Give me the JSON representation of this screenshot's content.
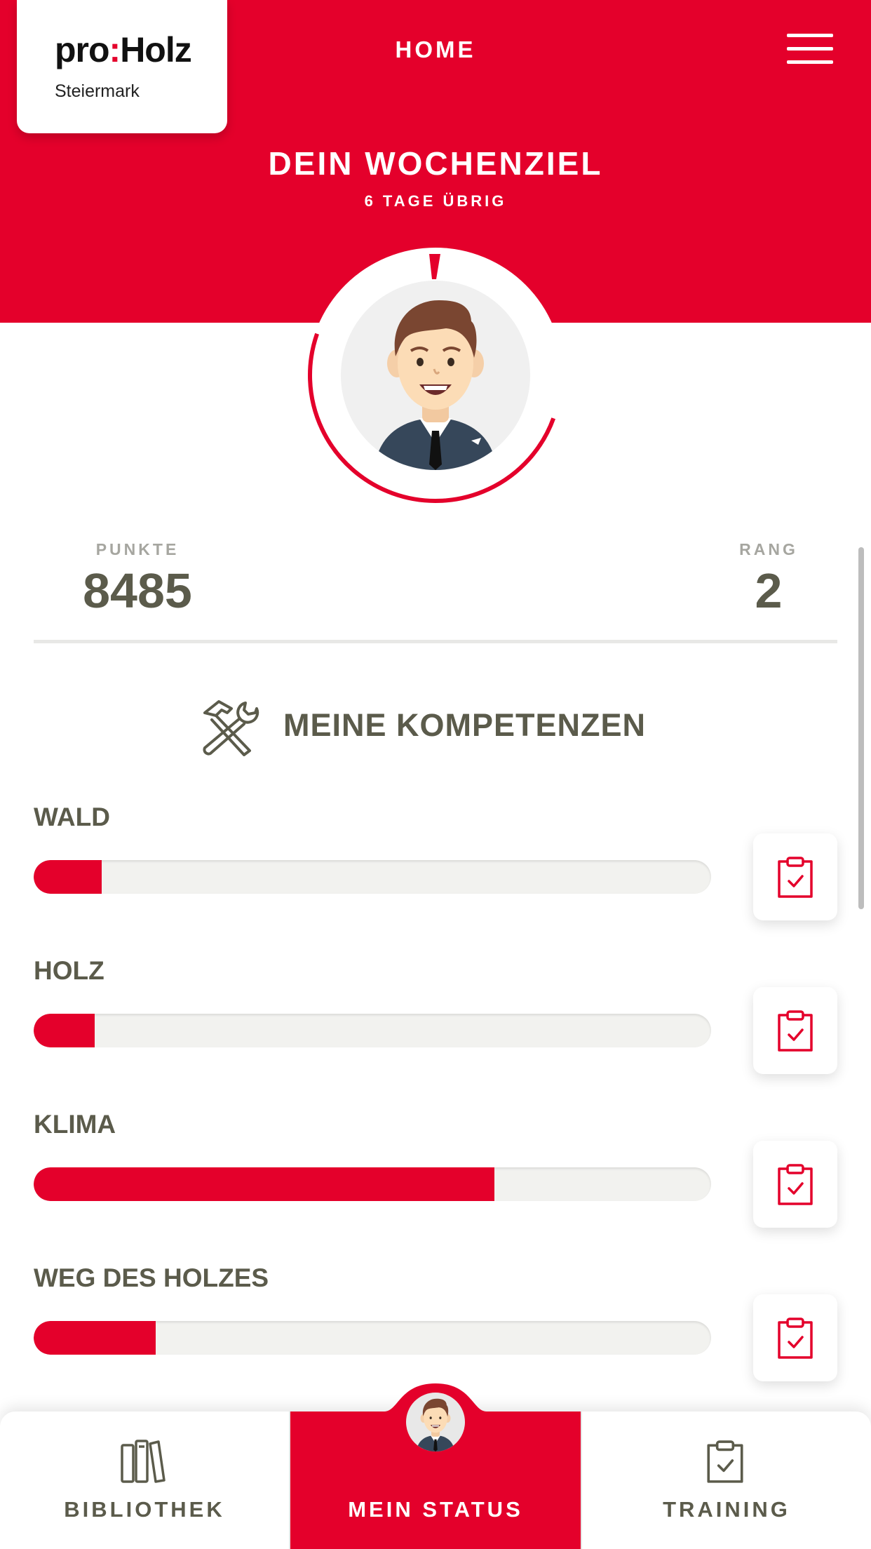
{
  "header": {
    "logo": {
      "brand_pre": "pro",
      "brand_colon": ":",
      "brand_post": "Holz",
      "sub": "Steiermark"
    },
    "title": "HOME",
    "menu_icon": "hamburger-menu-icon"
  },
  "goal": {
    "title": "DEIN WOCHENZIEL",
    "subtitle": "6 TAGE ÜBRIG"
  },
  "stats": {
    "points_label": "PUNKTE",
    "points_value": "8485",
    "rank_label": "RANG",
    "rank_value": "2"
  },
  "competencies": {
    "title": "MEINE KOMPETENZEN",
    "icon": "tools-icon",
    "items": [
      {
        "label": "WALD",
        "progress": 0.1,
        "action_icon": "clipboard-check-icon"
      },
      {
        "label": "HOLZ",
        "progress": 0.09,
        "action_icon": "clipboard-check-icon"
      },
      {
        "label": "KLIMA",
        "progress": 0.68,
        "action_icon": "clipboard-check-icon"
      },
      {
        "label": "WEG DES HOLZES",
        "progress": 0.18,
        "action_icon": "clipboard-check-icon"
      }
    ]
  },
  "nav": {
    "tabs": [
      {
        "label": "BIBLIOTHEK",
        "icon": "books-icon",
        "active": false
      },
      {
        "label": "MEIN STATUS",
        "icon": "avatar",
        "active": true
      },
      {
        "label": "TRAINING",
        "icon": "clipboard-check-icon",
        "active": false
      }
    ]
  },
  "colors": {
    "accent": "#e4002b",
    "text": "#5b5b4b",
    "muted": "#a6a6a0",
    "track": "#f2f2ef"
  }
}
